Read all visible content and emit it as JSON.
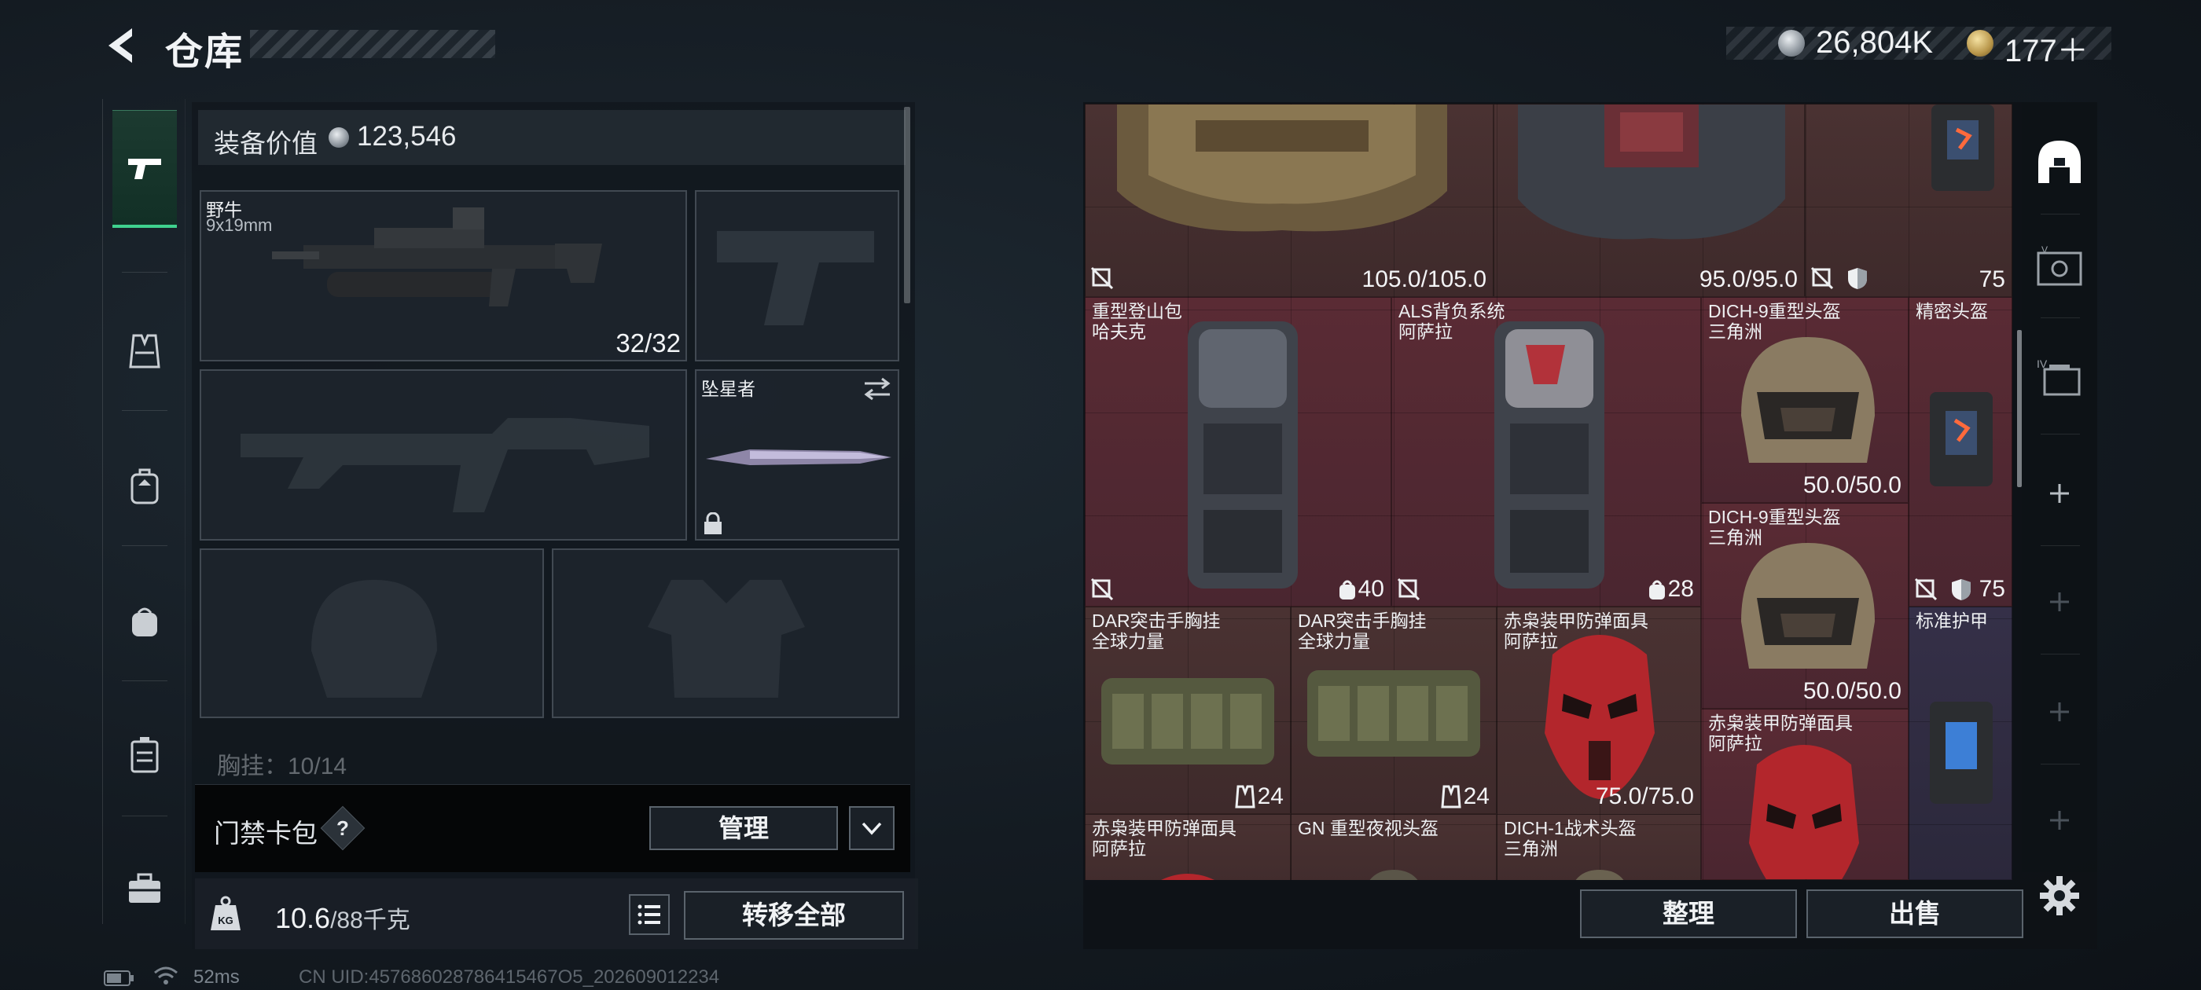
{
  "header": {
    "title": "仓库",
    "back_icon": "back-arrow-icon",
    "money": "26,804K",
    "tokens": "177＋"
  },
  "left_rail": {
    "items": [
      {
        "icon": "pistol-icon",
        "active": true
      },
      {
        "icon": "vest-icon",
        "active": false
      },
      {
        "icon": "backpack-icon",
        "active": false
      },
      {
        "icon": "bag-icon",
        "active": false
      },
      {
        "icon": "case-icon",
        "active": false
      },
      {
        "icon": "briefcase-icon",
        "active": false
      }
    ]
  },
  "loadout": {
    "equip_value_label": "装备价值",
    "equip_value": "123,546",
    "primary_weapon": {
      "name": "野牛",
      "caliber": "9x19mm",
      "ammo": "32/32"
    },
    "melee": {
      "name": "坠星者"
    },
    "rig_label": "胸挂：10/14"
  },
  "keycard": {
    "label": "门禁卡包",
    "help": "?",
    "manage": "管理"
  },
  "weight": {
    "current": "10.6",
    "capacity": "/88千克",
    "transfer_all": "转移全部"
  },
  "status": {
    "ping": "52ms",
    "uid": "CN UID:457686028786415467O5_202609012234"
  },
  "stash": {
    "items": [
      {
        "id": "armor-a",
        "name": "",
        "value": "105.0/105.0"
      },
      {
        "id": "armor-b",
        "name": "",
        "value": "95.0/95.0"
      },
      {
        "id": "armor-c",
        "name": "",
        "value": "75"
      },
      {
        "id": "backpack-1",
        "name": "重型登山包",
        "maker": "哈夫克",
        "value": "40"
      },
      {
        "id": "backpack-2",
        "name": "ALS背负系统",
        "maker": "阿萨拉",
        "value": "28"
      },
      {
        "id": "helmet-1",
        "name": "DICH-9重型头盔",
        "maker": "三角洲",
        "value": "50.0/50.0"
      },
      {
        "id": "helmet-precise",
        "name": "精密头盔",
        "maker": "",
        "value": "75"
      },
      {
        "id": "helmet-2",
        "name": "DICH-9重型头盔",
        "maker": "三角洲",
        "value": "50.0/50.0"
      },
      {
        "id": "rig-1",
        "name": "DAR突击手胸挂",
        "maker": "全球力量",
        "value": "24"
      },
      {
        "id": "rig-2",
        "name": "DAR突击手胸挂",
        "maker": "全球力量",
        "value": "24"
      },
      {
        "id": "mask-1",
        "name": "赤枭装甲防弹面具",
        "maker": "阿萨拉",
        "value": "75.0/75.0"
      },
      {
        "id": "armor-std",
        "name": "标准护甲",
        "maker": ""
      },
      {
        "id": "mask-2",
        "name": "赤枭装甲防弹面具",
        "maker": "阿萨拉"
      },
      {
        "id": "mask-3",
        "name": "赤枭装甲防弹面具",
        "maker": "阿萨拉"
      },
      {
        "id": "nvg-helmet",
        "name": "GN 重型夜视头盔",
        "maker": ""
      },
      {
        "id": "tactical-helmet",
        "name": "DICH-1战术头盔",
        "maker": "三角洲"
      }
    ],
    "sort": "整理",
    "sell": "出售"
  },
  "right_rail": {
    "items": [
      "home-icon",
      "case-transfer-icon",
      "storage-iv-icon",
      "plus-icon",
      "plus-icon",
      "plus-icon",
      "plus-icon"
    ],
    "settings": "gear-icon"
  },
  "colors": {
    "accent": "#3fd18e",
    "cell_brown": "#4a3232",
    "cell_red": "#5a2b34",
    "cell_purple": "#353048"
  }
}
